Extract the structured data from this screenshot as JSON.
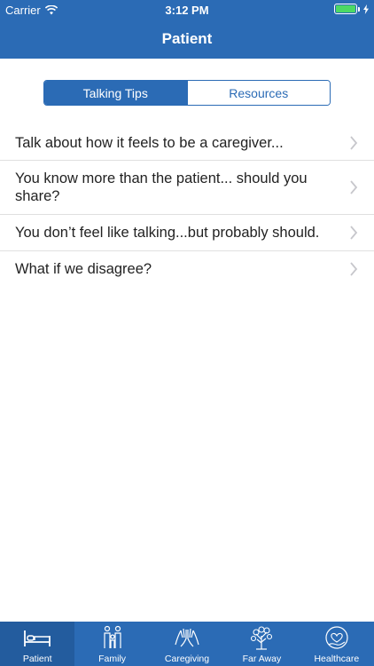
{
  "status_bar": {
    "carrier": "Carrier",
    "time": "3:12 PM"
  },
  "header": {
    "title": "Patient"
  },
  "segments": [
    {
      "label": "Talking Tips",
      "active": true
    },
    {
      "label": "Resources",
      "active": false
    }
  ],
  "tips": [
    "Talk about how it feels to be a caregiver...",
    "You know more than the patient... should you share?",
    "You don’t feel like talking...but probably should.",
    "What if we disagree?"
  ],
  "tabs": [
    {
      "label": "Patient",
      "icon": "bed-icon",
      "active": true
    },
    {
      "label": "Family",
      "icon": "family-icon",
      "active": false
    },
    {
      "label": "Caregiving",
      "icon": "hands-icon",
      "active": false
    },
    {
      "label": "Far Away",
      "icon": "tree-icon",
      "active": false
    },
    {
      "label": "Healthcare",
      "icon": "heart-hand-icon",
      "active": false
    }
  ],
  "colors": {
    "brand": "#2b6bb5",
    "tab_active": "#235c9e",
    "battery": "#4cd964"
  }
}
